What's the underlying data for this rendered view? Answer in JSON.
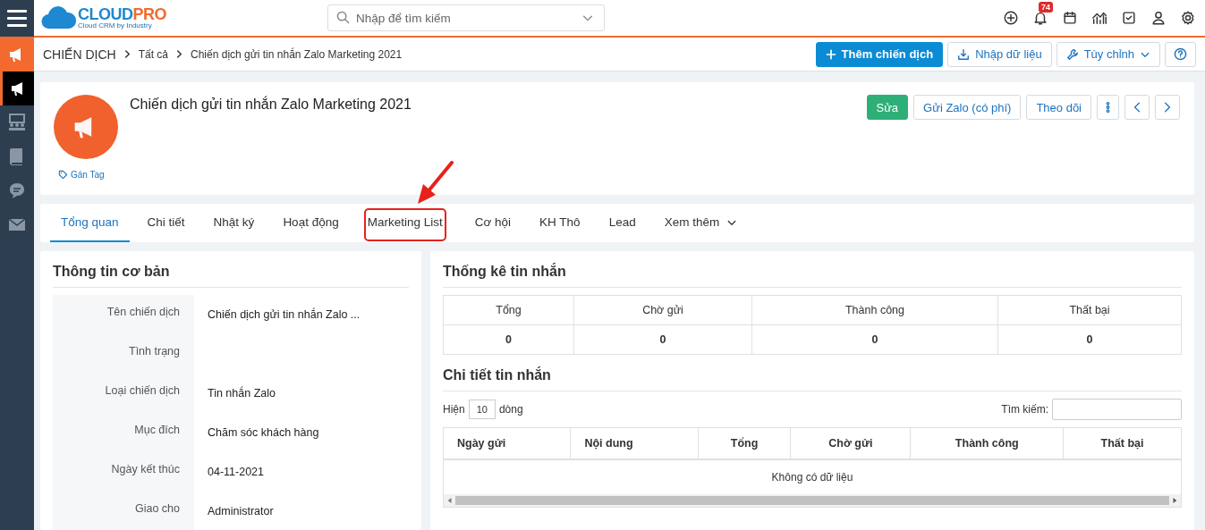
{
  "header": {
    "logo": {
      "brand_a": "CLOUD",
      "brand_b": "PRO",
      "tagline": "Cloud CRM by Industry"
    },
    "search": {
      "placeholder": "Nhập để tìm kiếm"
    },
    "notification_count": "74"
  },
  "sidebar": {
    "items": [
      {
        "selected": true,
        "hovered": false
      },
      {
        "selected": false,
        "hovered": true
      },
      {
        "selected": false,
        "hovered": false
      },
      {
        "selected": false,
        "hovered": false
      },
      {
        "selected": false,
        "hovered": false
      },
      {
        "selected": false,
        "hovered": false
      }
    ]
  },
  "breadcrumb": [
    "CHIẾN DỊCH",
    "Tất cả",
    "Chiến dịch gửi tin nhắn Zalo Marketing 2021"
  ],
  "toolbar": {
    "add_button": "Thêm chiến dịch",
    "import_button": "Nhập dữ liệu",
    "customize_button": "Tùy chỉnh"
  },
  "record": {
    "title": "Chiến dịch gửi tin nhắn Zalo Marketing 2021",
    "tag_link": "Gán Tag",
    "actions": [
      {
        "label": "Sửa",
        "kind": "primary"
      },
      {
        "label": "Gửi Zalo (có phí)",
        "kind": "outline"
      },
      {
        "label": "Theo dõi",
        "kind": "outline"
      }
    ]
  },
  "tabs": [
    {
      "label": "Tổng quan",
      "selected": true,
      "highlighted": false
    },
    {
      "label": "Chi tiết",
      "selected": false,
      "highlighted": false
    },
    {
      "label": "Nhật ký",
      "selected": false,
      "highlighted": false
    },
    {
      "label": "Hoạt động",
      "selected": false,
      "highlighted": false
    },
    {
      "label": "Marketing List",
      "selected": false,
      "highlighted": true
    },
    {
      "label": "Cơ hội",
      "selected": false,
      "highlighted": false
    },
    {
      "label": "KH Thô",
      "selected": false,
      "highlighted": false
    },
    {
      "label": "Lead",
      "selected": false,
      "highlighted": false
    },
    {
      "label": "Xem thêm",
      "selected": false,
      "highlighted": false,
      "dropdown": true
    }
  ],
  "basic_info": {
    "title": "Thông tin cơ bản",
    "fields": [
      {
        "label": "Tên chiến dịch",
        "value": "Chiến dịch gửi tin nhắn Zalo ..."
      },
      {
        "label": "Tình trạng"
      },
      {
        "label": "Loại chiến dịch",
        "value": "Tin nhắn Zalo"
      },
      {
        "label": "Mục đích",
        "value": "Chăm sóc khách hàng"
      },
      {
        "label": "Ngày kết thúc",
        "value": "04-11-2021"
      },
      {
        "label": "Giao cho",
        "value": "Administrator"
      }
    ]
  },
  "stats": {
    "title": "Thống kê tin nhắn",
    "columns": [
      "Tổng",
      "Chờ gửi",
      "Thành công",
      "Thất bại"
    ],
    "values": [
      "0",
      "0",
      "0",
      "0"
    ]
  },
  "details": {
    "title": "Chi tiết tin nhắn",
    "show_label": "Hiện",
    "page_size": "10",
    "rows_label": "dòng",
    "search_label": "Tìm kiếm:",
    "columns": [
      "Ngày gửi",
      "Nội dung",
      "Tổng",
      "Chờ gửi",
      "Thành công",
      "Thất bại"
    ],
    "empty_text": "Không có dữ liệu"
  }
}
